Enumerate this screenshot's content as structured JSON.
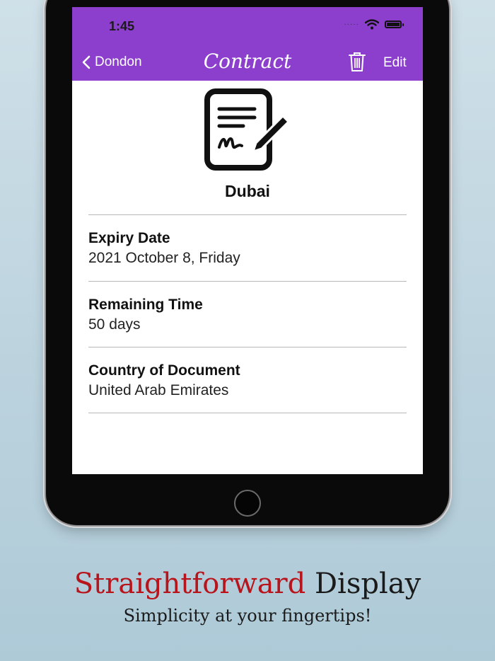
{
  "status_bar": {
    "time": "1:45",
    "signal": "·····"
  },
  "nav": {
    "back_label": "Dondon",
    "title": "Contract",
    "edit_label": "Edit"
  },
  "document": {
    "title": "Dubai",
    "fields": [
      {
        "label": "Expiry Date",
        "value": "2021 October 8, Friday"
      },
      {
        "label": "Remaining Time",
        "value": "50 days"
      },
      {
        "label": "Country of Document",
        "value": "United Arab Emirates"
      }
    ]
  },
  "caption": {
    "headline_accent": "Straightforward",
    "headline_rest": "Display",
    "subline": "Simplicity at your fingertips!"
  },
  "colors": {
    "header": "#8b3fcc",
    "accent_text": "#b8141c",
    "background": "#bcd3de"
  },
  "icons": [
    "chevron-left-icon",
    "trash-icon",
    "document-signature-icon",
    "wifi-icon",
    "battery-icon"
  ]
}
